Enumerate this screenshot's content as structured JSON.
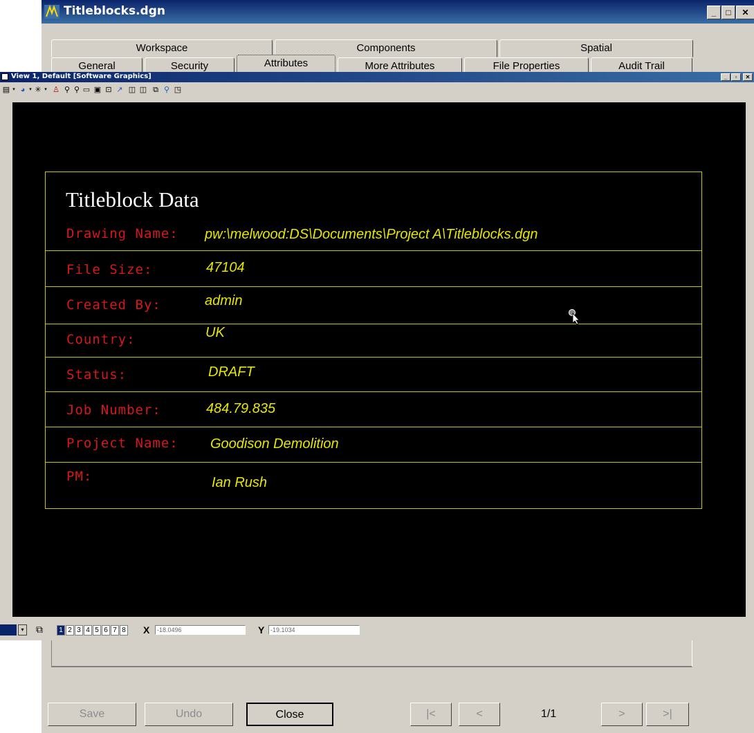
{
  "dialog": {
    "title": "Titleblocks.dgn",
    "tabs_back": [
      "Workspace",
      "Components",
      "Spatial"
    ],
    "tabs_front": [
      "General",
      "Security",
      "Attributes",
      "More Attributes",
      "File Properties",
      "Audit Trail"
    ],
    "active_tab": "Attributes",
    "buttons": {
      "save": "Save",
      "undo": "Undo",
      "close": "Close"
    },
    "nav": {
      "first": "|<",
      "prev": "<",
      "page": "1/1",
      "next": ">",
      "last": ">|"
    }
  },
  "view": {
    "title": "View 1, Default [Software Graphics]",
    "status": {
      "view_numbers": [
        "1",
        "2",
        "3",
        "4",
        "5",
        "6",
        "7",
        "8"
      ],
      "active_view": "1",
      "x_label": "X",
      "x_value": "-18.0496",
      "y_label": "Y",
      "y_value": "-19.1034"
    }
  },
  "titleblock": {
    "heading": "Titleblock Data",
    "rows": [
      {
        "label": "Drawing Name:",
        "value": "pw:\\melwood:DS\\Documents\\Project A\\Titleblocks.dgn"
      },
      {
        "label": "File Size:",
        "value": "47104"
      },
      {
        "label": "Created By:",
        "value": "admin"
      },
      {
        "label": "Country:",
        "value": "UK"
      },
      {
        "label": "Status:",
        "value": "DRAFT"
      },
      {
        "label": "Job Number:",
        "value": "484.79.835"
      },
      {
        "label": "Project Name:",
        "value": "Goodison Demolition"
      },
      {
        "label": "PM:",
        "value": "Ian Rush"
      }
    ]
  },
  "colors": {
    "label": "#d81818",
    "value": "#e6e600",
    "frame": "#c8c800",
    "title_bar": "#0a246a"
  }
}
